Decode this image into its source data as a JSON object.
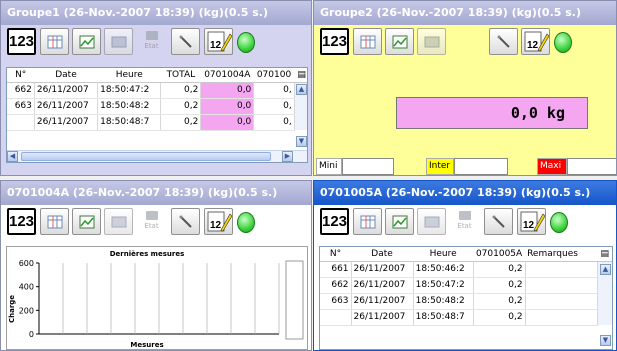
{
  "windows": {
    "groupe1": {
      "title": "Groupe1 (26-Nov.-2007 18:39) (kg)(0.5 s.)",
      "toolbar": {
        "counter_label": "123",
        "etat_label": "Etat",
        "calendar_day": "12"
      },
      "table": {
        "headers": [
          "N°",
          "Date",
          "Heure",
          "TOTAL",
          "0701004A",
          "070100"
        ],
        "rows": [
          [
            "662",
            "26/11/2007",
            "18:50:47:2",
            "0,2",
            "0,0",
            "0,"
          ],
          [
            "663",
            "26/11/2007",
            "18:50:48:2",
            "0,2",
            "0,0",
            "0,"
          ],
          [
            "",
            "26/11/2007",
            "18:50:48:7",
            "0,2",
            "0,0",
            "0,"
          ]
        ]
      }
    },
    "groupe2": {
      "title": "Groupe2 (26-Nov.-2007 18:39) (kg)(0.5 s.)",
      "toolbar": {
        "counter_label": "123",
        "calendar_day": "12"
      },
      "value_display": "0,0 kg",
      "thresholds": {
        "mini_label": "Mini",
        "inter_label": "Inter",
        "maxi_label": "Maxi",
        "mini_value": "",
        "inter_value": "",
        "maxi_value": ""
      }
    },
    "chart_window": {
      "title": "0701004A (26-Nov.-2007 18:39) (kg)(0.5 s.)",
      "toolbar": {
        "counter_label": "123",
        "etat_label": "Etat",
        "calendar_day": "12"
      }
    },
    "sensor_window": {
      "title": "0701005A (26-Nov.-2007 18:39) (kg)(0.5 s.)",
      "toolbar": {
        "counter_label": "123",
        "etat_label": "Etat",
        "calendar_day": "12"
      },
      "table": {
        "headers": [
          "N°",
          "Date",
          "Heure",
          "0701005A",
          "Remarques"
        ],
        "rows": [
          [
            "661",
            "26/11/2007",
            "18:50:46:2",
            "0,2",
            ""
          ],
          [
            "662",
            "26/11/2007",
            "18:50:47:2",
            "0,2",
            ""
          ],
          [
            "663",
            "26/11/2007",
            "18:50:48:2",
            "0,2",
            ""
          ],
          [
            "",
            "26/11/2007",
            "18:50:48:7",
            "0,2",
            ""
          ]
        ]
      }
    }
  },
  "chart_data": {
    "type": "bar",
    "title": "Dernières mesures",
    "xlabel": "Mesures",
    "ylabel": "Charge",
    "ylim": [
      0,
      600
    ],
    "yticks": [
      "600",
      "400",
      "200",
      "0"
    ],
    "categories": [
      "",
      "",
      "",
      "",
      "",
      "",
      "",
      "",
      "",
      ""
    ],
    "values": [
      0,
      0,
      0,
      0,
      0,
      0,
      0,
      0,
      0,
      0
    ],
    "grid": true
  },
  "colors": {
    "active_title": "#1655c8",
    "inactive_title": "#a3a8d0",
    "highlight_cell": "#f4a6f0",
    "display_bg": "#f4a6f0",
    "group2_bg": "#ffff99",
    "mini_label_bg": "#ffffff",
    "inter_label_bg": "#ffff00",
    "maxi_label_bg": "#ff0000",
    "led": "#3cd23c"
  }
}
